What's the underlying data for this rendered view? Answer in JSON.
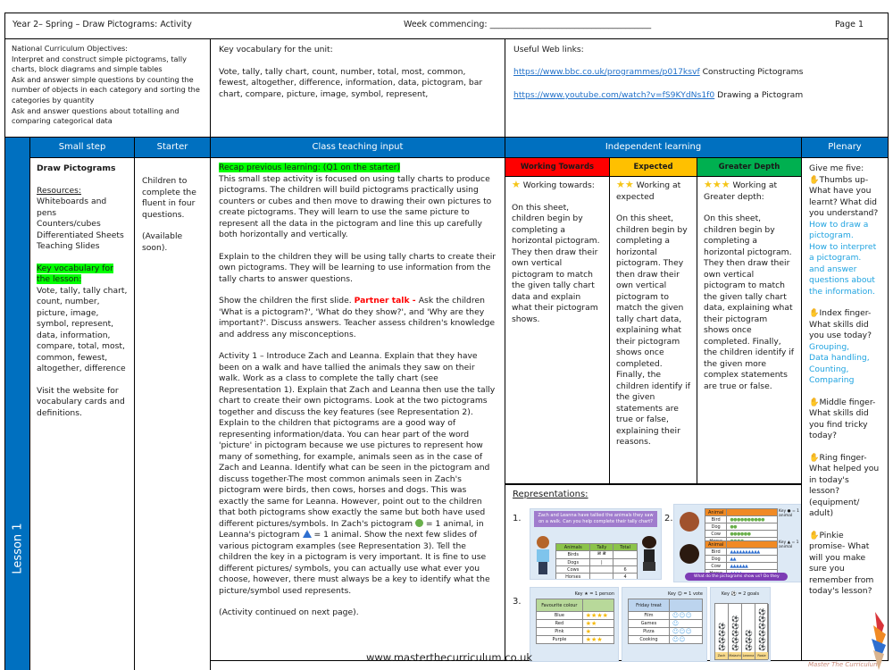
{
  "header": {
    "title": "Year 2– Spring – Draw Pictograms: Activity",
    "week_label": "Week commencing: ______________________________________",
    "page": "Page 1"
  },
  "objectives": {
    "heading": "National Curriculum Objectives:",
    "items": [
      "Interpret and construct simple pictograms, tally charts, block diagrams and simple tables",
      "Ask and answer simple questions by counting the number of objects in each category and sorting the categories by quantity",
      "Ask and answer questions about totalling and comparing categorical data"
    ]
  },
  "unit_vocabulary": {
    "heading": "Key vocabulary for the unit:",
    "text": "Vote, tally, tally chart, count, number, total, most, common, fewest, altogether, difference, information, data, pictogram, bar chart, compare, picture, image, symbol, represent,"
  },
  "web_links": {
    "heading": "Useful Web links:",
    "links": [
      {
        "url": "https://www.bbc.co.uk/programmes/p017ksvf",
        "label": "Constructing Pictograms"
      },
      {
        "url": "https://www.youtube.com/watch?v=fS9KYdNs1f0",
        "label": "Drawing a Pictogram"
      }
    ]
  },
  "columns": {
    "small_step": "Small step",
    "starter": "Starter",
    "class_teaching": "Class teaching input",
    "independent": "Independent learning",
    "plenary": "Plenary"
  },
  "lesson_label": "Lesson 1",
  "small_step": {
    "title": "Draw Pictograms",
    "resources_heading": "Resources:",
    "resources": [
      "Whiteboards and pens",
      "Counters/cubes",
      "Differentiated Sheets",
      "Teaching Slides"
    ],
    "vocab_heading": "Key vocabulary for the lesson:",
    "vocab": "Vote, tally, tally chart, count, number, picture, image, symbol, represent, data, information, compare, total, most, common, fewest, altogether, difference",
    "visit_note": "Visit the website for vocabulary cards and definitions."
  },
  "starter": {
    "text": "Children to complete the fluent in four questions.",
    "note": "(Available soon)."
  },
  "class_teaching": {
    "recap": "Recap previous learning: (Q1 on the starter)",
    "para1": "This small step activity is focused on using tally charts to produce pictograms. The children will build pictograms practically using counters or cubes and then move to drawing their own pictures to create pictograms. They will learn to use the same picture to represent all the data in the pictogram and line this up carefully both horizontally and vertically.",
    "para2": "Explain to the children they will be using tally charts to create their own pictograms. They will be learning to use information from the tally charts to answer questions.",
    "para3_a": "Show the children the first slide. ",
    "partner_talk": "Partner talk - ",
    "para3_b": "Ask the children 'What is a pictogram?', 'What do they show?', and 'Why are they important?'. Discuss answers. Teacher assess children's knowledge and address any misconceptions.",
    "para4_a": "Activity 1 – Introduce Zach and Leanna. Explain that they have been on a walk and have tallied the animals they saw on their walk. Work as a class to complete the tally chart (see Representation 1). Explain that Zach and Leanna then use the tally chart to create their own pictograms. Look at the two pictograms together and discuss the key features (see Representation 2). Explain to the children that pictograms are a good way of representing information/data. You can hear part of the word 'picture' in pictogram because we use pictures to represent how many of something, for example, animals seen as in the case of Zach and Leanna. Identify what can be seen in the pictogram and discuss together-The most common animals seen in Zach's pictogram were birds, then cows, horses and dogs. This was exactly the same for Leanna. However, point out to the children that both pictograms show exactly the same but both have used different pictures/symbols. In Zach's pictogram ",
    "para4_b": " = 1 animal, in Leanna's pictogram ",
    "para4_c": " = 1 animal. Show the next few slides of various pictogram examples (see Representation 3). Tell the children the key in a pictogram is very important. It is fine to use different pictures/ symbols, you can actually use what ever you choose, however, there must always be a key to identify what the picture/symbol used represents.",
    "continued": "(Activity continued on next page)."
  },
  "independent": {
    "levels": [
      {
        "label": "Working Towards",
        "color": "#ff0000",
        "stars": "★",
        "title": "Working towards:",
        "text": "On this sheet, children begin by completing a horizontal pictogram. They then draw their own vertical pictogram to match the given tally chart data and explain what their pictogram shows."
      },
      {
        "label": "Expected",
        "color": "#ffc000",
        "stars": "★★",
        "title": "Working at expected",
        "text": "On this sheet, children begin by completing a horizontal pictogram. They then draw their own vertical pictogram to match the given tally chart data, explaining what their pictogram shows once completed. Finally, the children identify if the given statements are true or false, explaining their reasons."
      },
      {
        "label": "Greater Depth",
        "color": "#00b050",
        "stars": "★★★",
        "title": "Working at Greater depth:",
        "text": "On this sheet, children begin by completing a horizontal pictogram. They then draw their own vertical pictogram to match the given tally chart data, explaining what their pictogram shows once completed. Finally, the children identify if the given more complex statements are true or false."
      }
    ]
  },
  "representations": {
    "heading": "Representations:",
    "rep1": {
      "num": "1.",
      "banner": "Zach and Leanna have tallied the animals they saw on a walk. Can you help complete their tally chart?",
      "headers": [
        "Animals",
        "Tally",
        "Total"
      ],
      "rows": [
        [
          "Birds",
          "𝍸 𝍸",
          ""
        ],
        [
          "Dogs",
          "|",
          ""
        ],
        [
          "Cows",
          "",
          "6"
        ],
        [
          "Horses",
          "",
          "4"
        ]
      ]
    },
    "rep2": {
      "num": "2.",
      "header": "Animal",
      "key1": "Key ● = 1 animal",
      "key2": "Key ▲ = 1 animal",
      "animals": [
        "Bird",
        "Dog",
        "Cow",
        "Horse"
      ],
      "counts": [
        10,
        2,
        6,
        4
      ],
      "question": "What do the pictograms show us? Do they show the same?"
    },
    "rep3": {
      "num": "3.",
      "colour": {
        "key": "Key ★ = 1 person",
        "header": "Favourite colour",
        "rows": [
          [
            "Blue",
            4
          ],
          [
            "Red",
            2
          ],
          [
            "Pink",
            1
          ],
          [
            "Purple",
            3
          ]
        ]
      },
      "treat": {
        "key": "Key ☺ = 1 vote",
        "header": "Friday treat",
        "rows": [
          [
            "Film",
            3
          ],
          [
            "Games",
            1
          ],
          [
            "Pizza",
            3
          ],
          [
            "Cooking",
            2
          ]
        ]
      },
      "goals": {
        "key": "Key ⚽ = 2 goals",
        "names": [
          "Zach",
          "Malachi",
          "Leanna",
          "Rosie"
        ],
        "counts": [
          4,
          5,
          3,
          6
        ]
      }
    }
  },
  "plenary": {
    "intro": "Give me five:",
    "thumb": "Thumbs up- What have you learnt? What did you understand?",
    "thumb_answers": [
      "How to draw a pictogram.",
      "How to interpret a pictogram.",
      "and answer questions about the information."
    ],
    "index": "Index finger- What skills did you use today?",
    "index_answers": [
      "Grouping,",
      "Data handling,",
      "Counting,",
      "Comparing"
    ],
    "middle": "Middle finger- What skills did you find tricky today?",
    "ring": "Ring finger- What helped you in today's lesson? (equipment/ adult)",
    "pinkie": "Pinkie promise- What will you make sure you remember from today's lesson?"
  },
  "footer": {
    "url": "www.masterthecurriculum.co.uk",
    "brand": "Master The Curriculum"
  }
}
